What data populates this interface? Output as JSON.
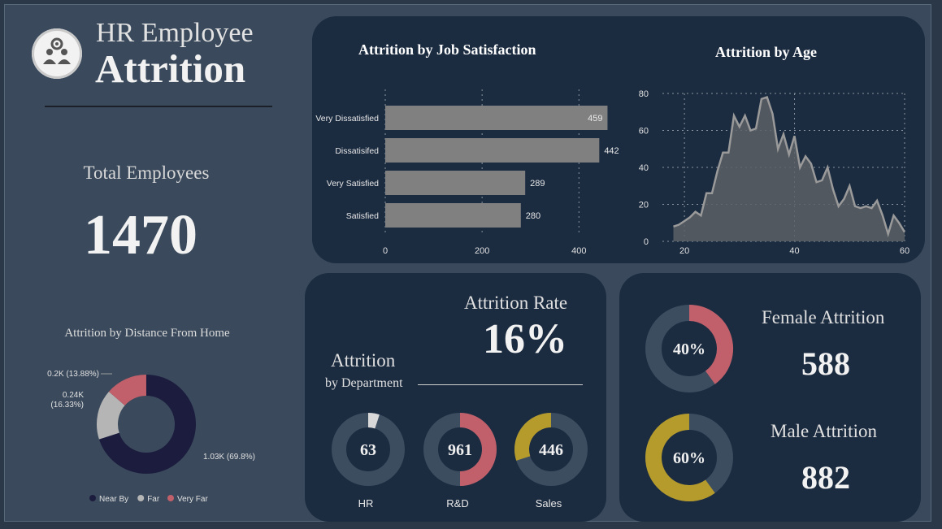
{
  "header": {
    "title_line1": "HR Employee",
    "title_line2": "Attrition",
    "logo_icon": "team-gear-icon"
  },
  "kpis": {
    "total_employees_label": "Total Employees",
    "total_employees_value": "1470",
    "attrition_rate_label": "Attrition Rate",
    "attrition_rate_value": "16%",
    "female_label": "Female Attrition",
    "female_value": "588",
    "female_pct": "40%",
    "male_label": "Male Attrition",
    "male_value": "882",
    "male_pct": "60%"
  },
  "department": {
    "title": "Attrition",
    "subtitle": "by Department"
  },
  "colors": {
    "background": "#3a4a5c",
    "card": "#1b2b40",
    "bar": "#808080",
    "near_by": "#1c1d3e",
    "far": "#b5b5b5",
    "very_far": "#c1606a",
    "gold": "#b59b2c",
    "track": "#3d4d60",
    "area": "#5a6066"
  },
  "chart_data": [
    {
      "type": "bar",
      "title": "Attrition by Job Satisfaction",
      "categories": [
        "Very Dissatisfied",
        "Dissatisifed",
        "Very Satisfied",
        "Satisfied"
      ],
      "values": [
        459,
        442,
        289,
        280
      ],
      "xticks": [
        0,
        200,
        400
      ],
      "xlim": [
        0,
        470
      ],
      "grid": true
    },
    {
      "type": "area",
      "title": "Attrition by Age",
      "x": [
        18,
        19,
        20,
        21,
        22,
        23,
        24,
        25,
        26,
        27,
        28,
        29,
        30,
        31,
        32,
        33,
        34,
        35,
        36,
        37,
        38,
        39,
        40,
        41,
        42,
        43,
        44,
        45,
        46,
        47,
        48,
        49,
        50,
        51,
        52,
        53,
        54,
        55,
        56,
        57,
        58,
        59,
        60
      ],
      "y": [
        8,
        9,
        11,
        13,
        16,
        14,
        26,
        26,
        38,
        48,
        48,
        68,
        62,
        68,
        60,
        61,
        77,
        78,
        69,
        50,
        58,
        47,
        57,
        40,
        46,
        42,
        32,
        33,
        40,
        28,
        19,
        23,
        30,
        19,
        18,
        19,
        18,
        22,
        14,
        4,
        14,
        10,
        5
      ],
      "xticks": [
        20,
        40,
        60
      ],
      "yticks": [
        0,
        20,
        40,
        60,
        80
      ],
      "xlim": [
        16,
        60
      ],
      "ylim": [
        0,
        80
      ],
      "grid": true
    },
    {
      "type": "pie",
      "title": "Attrition by Distance From Home",
      "labels": [
        "Near By",
        "Far",
        "Very Far"
      ],
      "values": [
        1030,
        240,
        200
      ],
      "data_labels": [
        "1.03K (69.8%)",
        "0.24K\n(16.33%)",
        "0.2K (13.88%)"
      ],
      "legend": "bottom"
    },
    {
      "type": "pie",
      "title": "Attrition by Department",
      "series": [
        {
          "name": "HR",
          "value": 63,
          "share": 0.05
        },
        {
          "name": "R&D",
          "value": 961,
          "share": 0.5
        },
        {
          "name": "Sales",
          "value": 446,
          "share": 0.3
        }
      ]
    }
  ]
}
